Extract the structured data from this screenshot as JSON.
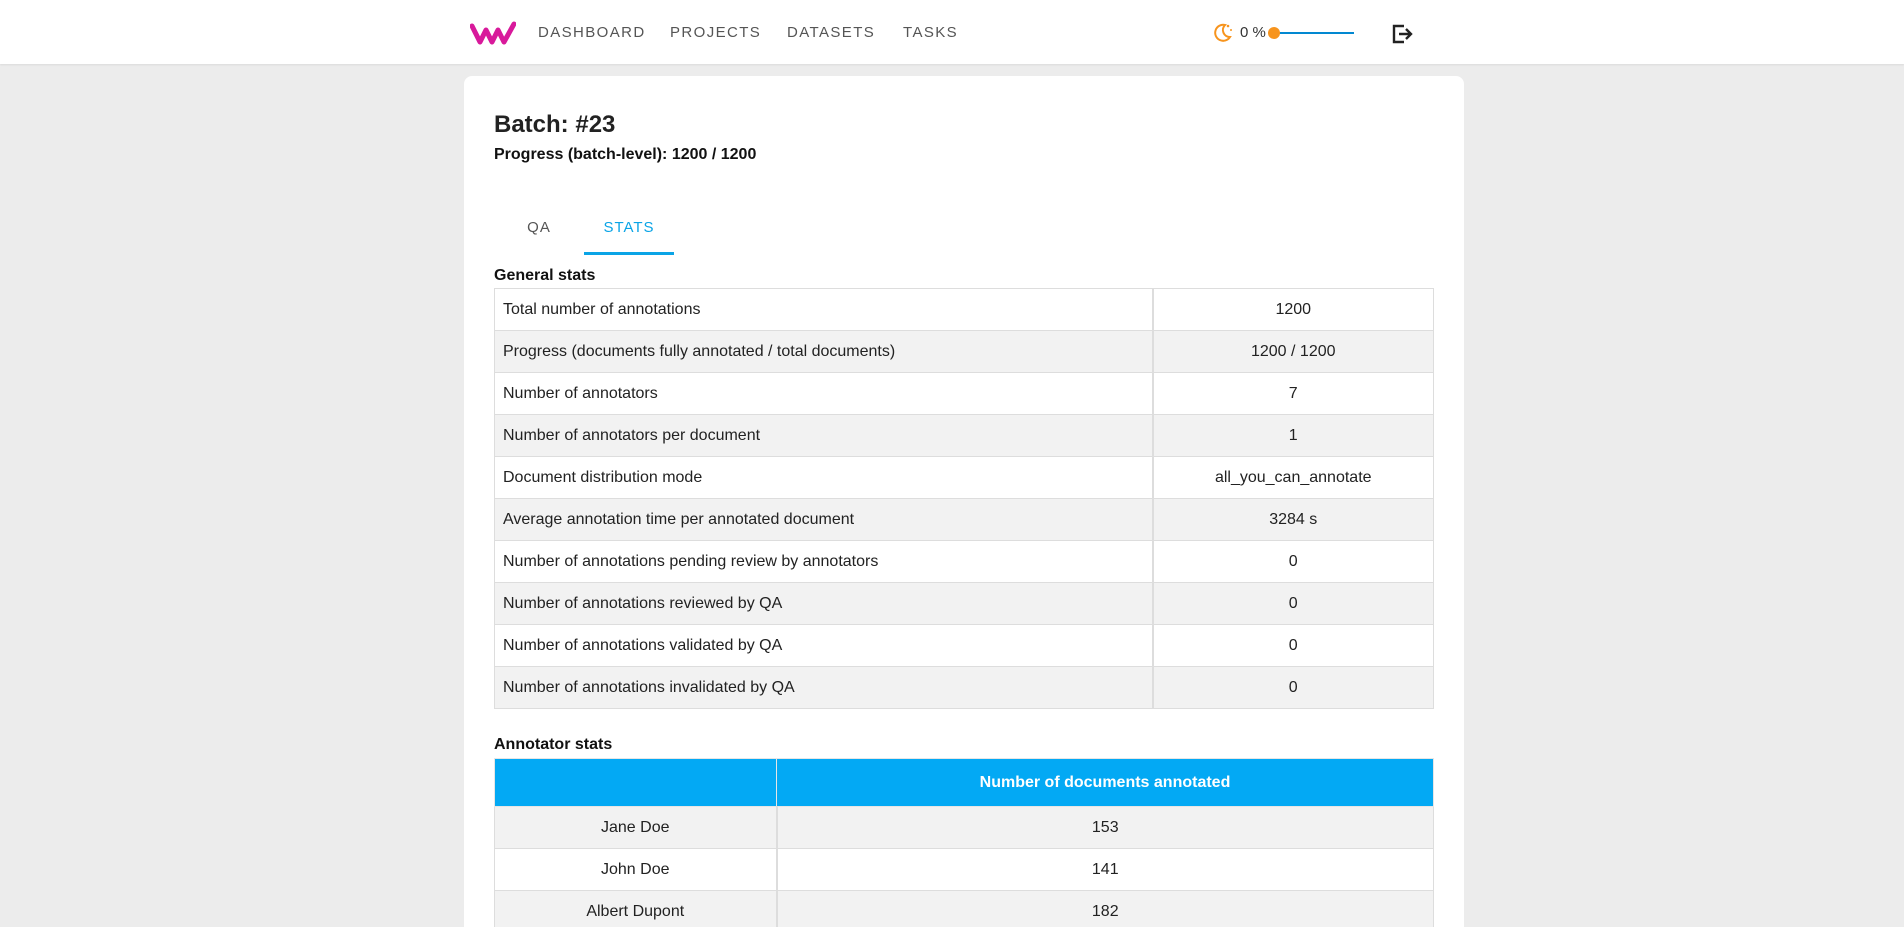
{
  "nav": {
    "links": [
      "DASHBOARD",
      "PROJECTS",
      "DATASETS",
      "TASKS"
    ],
    "zoom_text": "0 %",
    "zoom_slider_fraction": 0
  },
  "batch": {
    "title": "Batch: #23",
    "progress": "Progress (batch-level): 1200 / 1200"
  },
  "tabs": [
    "QA",
    "STATS"
  ],
  "active_tab": "STATS",
  "general_stats": {
    "title": "General stats",
    "rows": [
      {
        "label": "Total number of annotations",
        "value": "1200"
      },
      {
        "label": "Progress (documents fully annotated / total documents)",
        "value": "1200 / 1200"
      },
      {
        "label": "Number of annotators",
        "value": "7"
      },
      {
        "label": "Number of annotators per document",
        "value": "1"
      },
      {
        "label": "Document distribution mode",
        "value": "all_you_can_annotate"
      },
      {
        "label": "Average annotation time per annotated document",
        "value": "3284 s"
      },
      {
        "label": "Number of annotations pending review by annotators",
        "value": "0"
      },
      {
        "label": "Number of annotations reviewed by QA",
        "value": "0"
      },
      {
        "label": "Number of annotations validated by QA",
        "value": "0"
      },
      {
        "label": "Number of annotations invalidated by QA",
        "value": "0"
      }
    ]
  },
  "annotator_stats": {
    "title": "Annotator stats",
    "headers": [
      "",
      "Number of documents annotated"
    ],
    "rows": [
      {
        "name": "Jane Doe",
        "count": "153"
      },
      {
        "name": "John Doe",
        "count": "141"
      },
      {
        "name": "Albert Dupont",
        "count": "182"
      }
    ]
  },
  "colors": {
    "accent": "#03a9f4",
    "logo": "#d8199b",
    "slider_thumb": "#f7941d"
  }
}
